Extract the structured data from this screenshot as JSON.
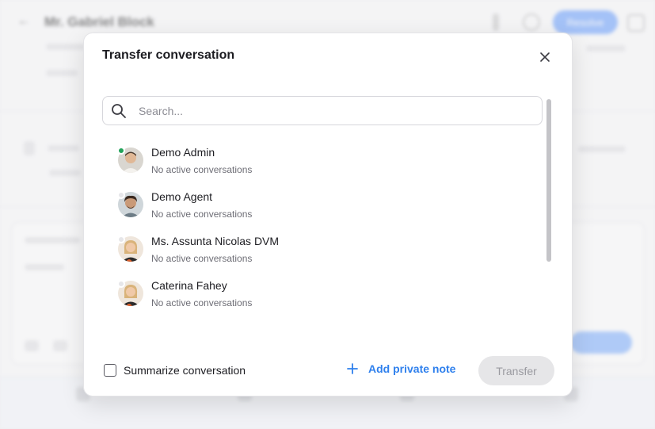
{
  "background": {
    "header_title": "Mr. Gabriel Block",
    "action_label": "Resolve"
  },
  "modal": {
    "title": "Transfer conversation",
    "search": {
      "placeholder": "Search...",
      "value": ""
    },
    "agents": [
      {
        "name": "Demo Admin",
        "subtitle": "No active conversations",
        "status": "online",
        "avatar": "avatar-demo-admin"
      },
      {
        "name": "Demo Agent",
        "subtitle": "No active conversations",
        "status": "offline",
        "avatar": "avatar-demo-agent"
      },
      {
        "name": "Ms. Assunta Nicolas DVM",
        "subtitle": "No active conversations",
        "status": "offline",
        "avatar": "avatar-assunta"
      },
      {
        "name": "Caterina Fahey",
        "subtitle": "No active conversations",
        "status": "offline",
        "avatar": "avatar-caterina"
      }
    ],
    "summarize_label": "Summarize conversation",
    "summarize_checked": false,
    "add_note_label": "Add private note",
    "transfer_label": "Transfer",
    "transfer_enabled": false
  },
  "colors": {
    "accent": "#2f80ed",
    "online": "#22a35a",
    "disabled_bg": "#e6e6e8"
  }
}
